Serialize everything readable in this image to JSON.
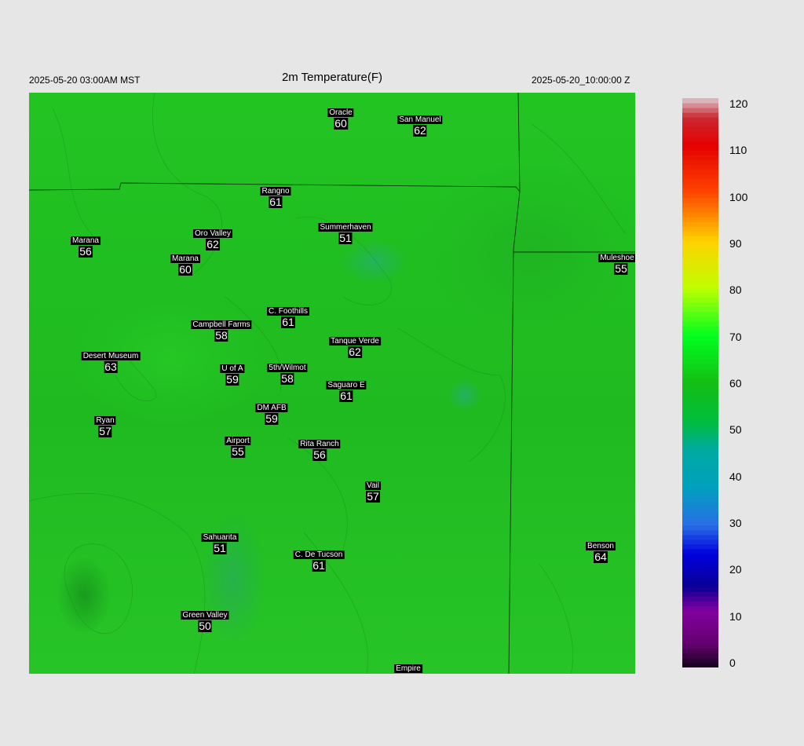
{
  "header": {
    "local_time": "2025-05-20 03:00AM MST",
    "title": "2m Temperature(F)",
    "valid_time": "2025-05-20_10:00:00 Z"
  },
  "stations": [
    {
      "name": "Oracle",
      "value": "60"
    },
    {
      "name": "San Manuel",
      "value": "62"
    },
    {
      "name": "Rangno",
      "value": "61"
    },
    {
      "name": "Summerhaven",
      "value": "51"
    },
    {
      "name": "Marana",
      "value": "56"
    },
    {
      "name": "Oro Valley",
      "value": "62"
    },
    {
      "name": "Marana",
      "value": "60"
    },
    {
      "name": "Muleshoe R",
      "value": "55"
    },
    {
      "name": "C. Foothills",
      "value": "61"
    },
    {
      "name": "Campbell Farms",
      "value": "58"
    },
    {
      "name": "Tanque Verde",
      "value": "62"
    },
    {
      "name": "Desert Museum",
      "value": "63"
    },
    {
      "name": "U of A",
      "value": "59"
    },
    {
      "name": "5th/Wilmot",
      "value": "58"
    },
    {
      "name": "Saguaro E",
      "value": "61"
    },
    {
      "name": "DM AFB",
      "value": "59"
    },
    {
      "name": "Ryan",
      "value": "57"
    },
    {
      "name": "Airport",
      "value": "55"
    },
    {
      "name": "Rita Ranch",
      "value": "56"
    },
    {
      "name": "Vail",
      "value": "57"
    },
    {
      "name": "Sahuarita",
      "value": "51"
    },
    {
      "name": "C. De Tucson",
      "value": "61"
    },
    {
      "name": "Benson",
      "value": "64"
    },
    {
      "name": "Green Valley",
      "value": "50"
    },
    {
      "name": "Empire",
      "value": ""
    }
  ],
  "colorbar": {
    "min": 0,
    "max": 120,
    "ticks": [
      "120",
      "110",
      "100",
      "90",
      "80",
      "70",
      "60",
      "50",
      "40",
      "30",
      "20",
      "10",
      "0"
    ]
  },
  "colors": {
    "background": "#e6e6e6",
    "map_green": "#22c422",
    "label_bg": "#000000",
    "label_fg": "#ffffff"
  }
}
